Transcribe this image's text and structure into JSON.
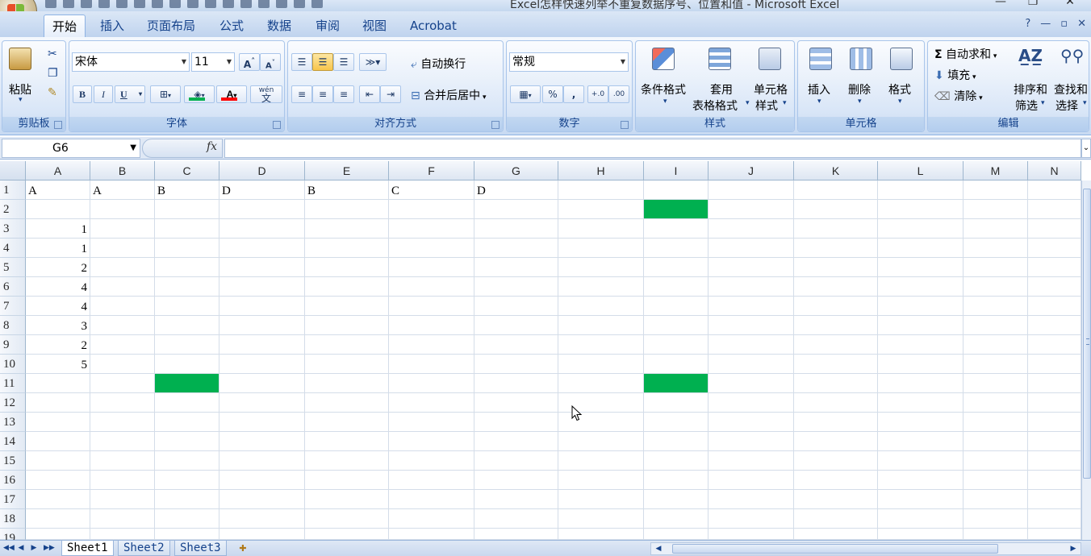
{
  "window": {
    "title": "Excel怎样快速列举不重复数据序号、位置和值 - Microsoft Excel",
    "minimize": "—",
    "restore": "❐",
    "close": "✕"
  },
  "tabs": [
    {
      "label": "开始",
      "active": true
    },
    {
      "label": "插入"
    },
    {
      "label": "页面布局"
    },
    {
      "label": "公式"
    },
    {
      "label": "数据"
    },
    {
      "label": "审阅"
    },
    {
      "label": "视图"
    },
    {
      "label": "Acrobat"
    }
  ],
  "help_controls": {
    "help": "?",
    "min": "—",
    "restore": "▫",
    "close": "✕"
  },
  "ribbon": {
    "clipboard": {
      "label": "剪贴板",
      "paste": "粘贴"
    },
    "font": {
      "label": "字体",
      "font_name": "宋体",
      "font_size": "11",
      "grow": "A",
      "shrink": "A",
      "bold": "B",
      "italic": "I",
      "underline": "U",
      "phonetic": "wén",
      "phonetic_char": "文",
      "fill_color": "#00b050",
      "font_color": "#ff0000"
    },
    "alignment": {
      "label": "对齐方式",
      "wrap_text": "自动换行",
      "merge_center": "合并后居中"
    },
    "number": {
      "label": "数字",
      "format": "常规",
      "percent": "%",
      "comma": ",",
      "inc_decimal": "+.0",
      "dec_decimal": ".00"
    },
    "styles": {
      "label": "样式",
      "conditional": "条件格式",
      "table_1": "套用",
      "table_2": "表格格式",
      "cell_style_1": "单元格",
      "cell_style_2": "样式"
    },
    "cells": {
      "label": "单元格",
      "insert": "插入",
      "delete": "删除",
      "format": "格式"
    },
    "editing": {
      "label": "编辑",
      "autosum": "自动求和",
      "fill": "填充",
      "clear": "清除",
      "sort_1": "排序和",
      "sort_2": "筛选",
      "find_1": "查找和",
      "find_2": "选择"
    }
  },
  "formula_bar": {
    "name_box": "G6",
    "fx": "fx",
    "formula": ""
  },
  "columns": [
    "A",
    "B",
    "C",
    "D",
    "E",
    "F",
    "G",
    "H",
    "I",
    "J",
    "K",
    "L",
    "M",
    "N"
  ],
  "rows": [
    "1",
    "2",
    "3",
    "4",
    "5",
    "6",
    "7",
    "8",
    "9",
    "10",
    "11",
    "12",
    "13",
    "14",
    "15",
    "16",
    "17",
    "18",
    "19"
  ],
  "cells": [
    {
      "ref": "A1",
      "value": "A"
    },
    {
      "ref": "B1",
      "value": "A"
    },
    {
      "ref": "C1",
      "value": "B"
    },
    {
      "ref": "D1",
      "value": "D"
    },
    {
      "ref": "E1",
      "value": "B"
    },
    {
      "ref": "F1",
      "value": "C"
    },
    {
      "ref": "G1",
      "value": "D"
    },
    {
      "ref": "A3",
      "value": "1"
    },
    {
      "ref": "A4",
      "value": "1"
    },
    {
      "ref": "A5",
      "value": "2"
    },
    {
      "ref": "A6",
      "value": "4"
    },
    {
      "ref": "A7",
      "value": "4"
    },
    {
      "ref": "A8",
      "value": "3"
    },
    {
      "ref": "A9",
      "value": "2"
    },
    {
      "ref": "A10",
      "value": "5"
    }
  ],
  "highlight_color": "#00b050",
  "highlighted_cells": [
    "I2",
    "C11",
    "I11"
  ],
  "sheets": [
    {
      "label": "Sheet1",
      "active": true
    },
    {
      "label": "Sheet2"
    },
    {
      "label": "Sheet3"
    }
  ],
  "sheet_nav": [
    "◀◀",
    "◀",
    "▶",
    "▶▶"
  ]
}
